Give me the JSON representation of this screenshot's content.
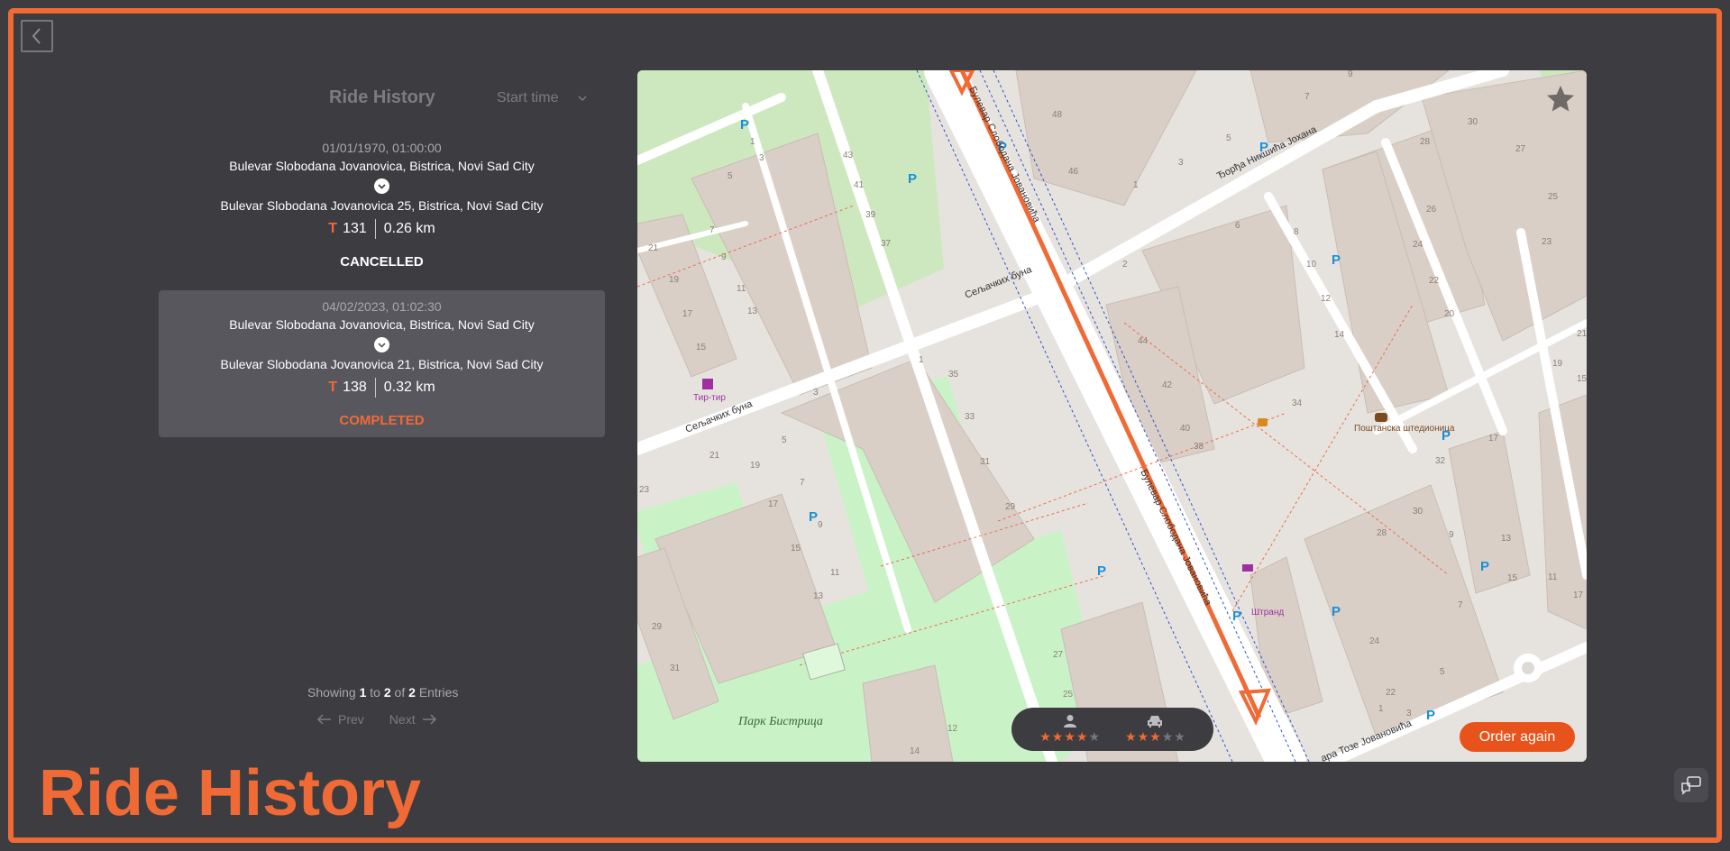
{
  "page": {
    "title": "Ride History",
    "accent_color": "#f06a35"
  },
  "nav": {
    "back_icon": "chevron-left-icon"
  },
  "panel": {
    "title": "Ride History",
    "sort": {
      "selected": "Start time",
      "icon": "chevron-down-icon"
    }
  },
  "rides": [
    {
      "date": "01/01/1970, 01:00:00",
      "from": "Bulevar Slobodana Jovanovica, Bistrica, Novi Sad City",
      "to": "Bulevar Slobodana Jovanovica 25, Bistrica, Novi Sad City",
      "t_label": "T",
      "cost": "131",
      "distance": "0.26 km",
      "status": "CANCELLED",
      "status_color": "#ffffff"
    },
    {
      "date": "04/02/2023, 01:02:30",
      "from": "Bulevar Slobodana Jovanovica, Bistrica, Novi Sad City",
      "to": "Bulevar Slobodana Jovanovica 21, Bistrica, Novi Sad City",
      "t_label": "T",
      "cost": "138",
      "distance": "0.32 km",
      "status": "COMPLETED",
      "status_color": "#f06a35"
    }
  ],
  "pagination": {
    "showing_prefix": "Showing",
    "from": "1",
    "to_word": "to",
    "to": "2",
    "of_word": "of",
    "total": "2",
    "suffix": "Entries",
    "prev": "Prev",
    "next": "Next"
  },
  "map": {
    "labels": {
      "street_1": "Булевар Слободана Јовановића",
      "street_2": "Ђорђа Никшића Јохана",
      "street_3": "Сељачких буна",
      "street_4": "Сељачких буна",
      "street_5": "Булевар Слободана Јовановића",
      "street_6": "ара Тозе Јовановића",
      "park": "Парк Бистрица",
      "poi_1": "Тир-тир",
      "poi_2": "Штранд",
      "poi_3": "Поштанска штедионица"
    },
    "favorite_icon": "star-icon",
    "passenger_rating": {
      "icon": "person-icon",
      "filled": 4,
      "total": 5
    },
    "vehicle_rating": {
      "icon": "car-icon",
      "filled": 3,
      "total": 5
    },
    "order_again": "Order again"
  },
  "chat_icon": "chat-icon"
}
